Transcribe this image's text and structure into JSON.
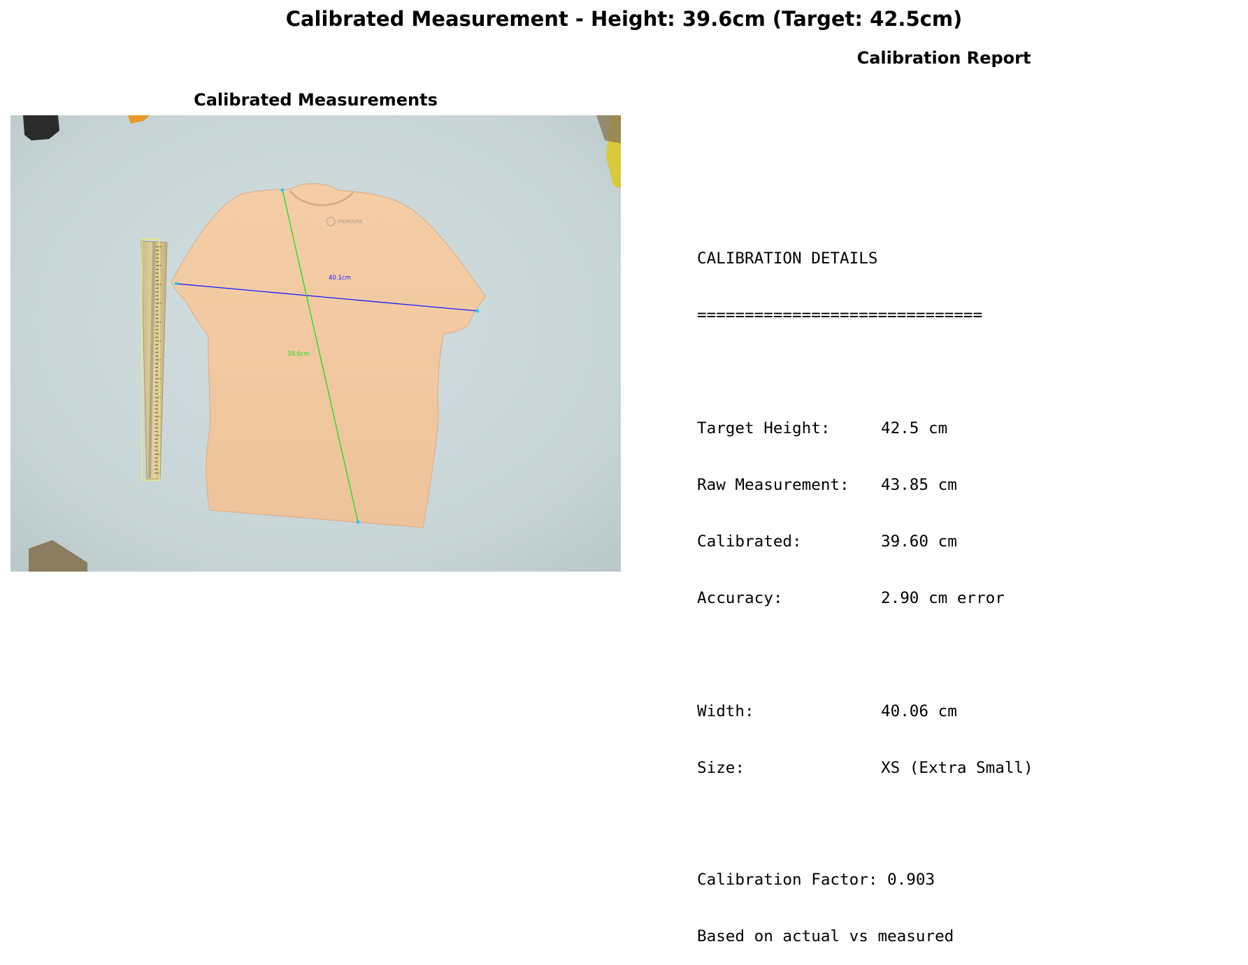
{
  "figure": {
    "title": "Calibrated Measurement - Height: 39.6cm (Target: 42.5cm)"
  },
  "left_panel": {
    "title": "Calibrated Measurements",
    "width_annotation": "40.1cm",
    "height_annotation": "39.6cm",
    "garment_logo_text": "PRIMARK"
  },
  "right_panel": {
    "title": "Calibration Report",
    "heading": "CALIBRATION DETAILS",
    "separator": "==============================",
    "rows": [
      {
        "label": "Target Height:",
        "value": "42.5 cm"
      },
      {
        "label": "Raw Measurement:",
        "value": "43.85 cm"
      },
      {
        "label": "Calibrated:",
        "value": "39.60 cm"
      },
      {
        "label": "Accuracy:",
        "value": "2.90 cm error"
      },
      {
        "label": "Width:",
        "value": "40.06 cm"
      },
      {
        "label": "Size:",
        "value": "XS (Extra Small)"
      }
    ],
    "factor_line": "Calibration Factor: 0.903",
    "note_line": "Based on actual vs measured"
  },
  "colors": {
    "width_line": "#1a1aff",
    "height_line": "#22e022",
    "ruler_box": "#f0f060",
    "background_surface": "#c9d6d8",
    "shirt": "#f1caa2"
  }
}
